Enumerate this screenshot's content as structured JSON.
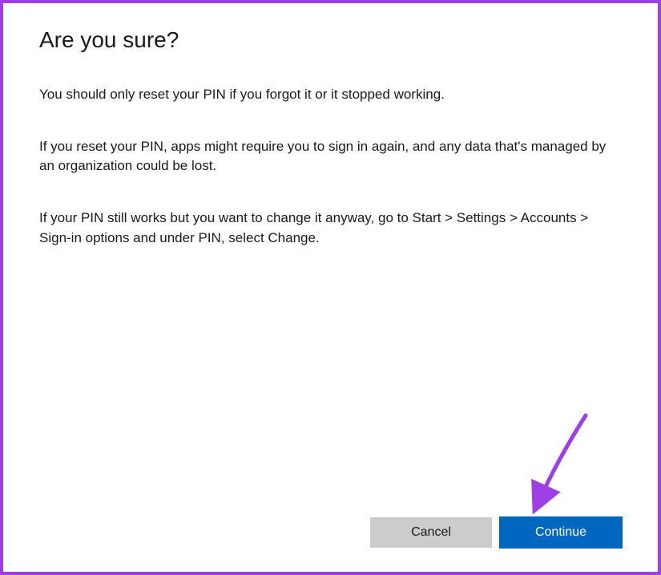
{
  "dialog": {
    "title": "Are you sure?",
    "paragraph1": "You should only reset your PIN if you forgot it or it stopped working.",
    "paragraph2": "If you reset your PIN, apps might require you to sign in again, and any data that's managed by an organization could be lost.",
    "paragraph3": "If your PIN still works but you want to change it anyway, go to Start > Settings > Accounts > Sign-in options and under PIN, select Change."
  },
  "buttons": {
    "cancel": "Cancel",
    "continue": "Continue"
  },
  "colors": {
    "border": "#9c3fe6",
    "primary_button": "#0067c0",
    "secondary_button": "#cccccc",
    "arrow": "#9c3fe6"
  }
}
